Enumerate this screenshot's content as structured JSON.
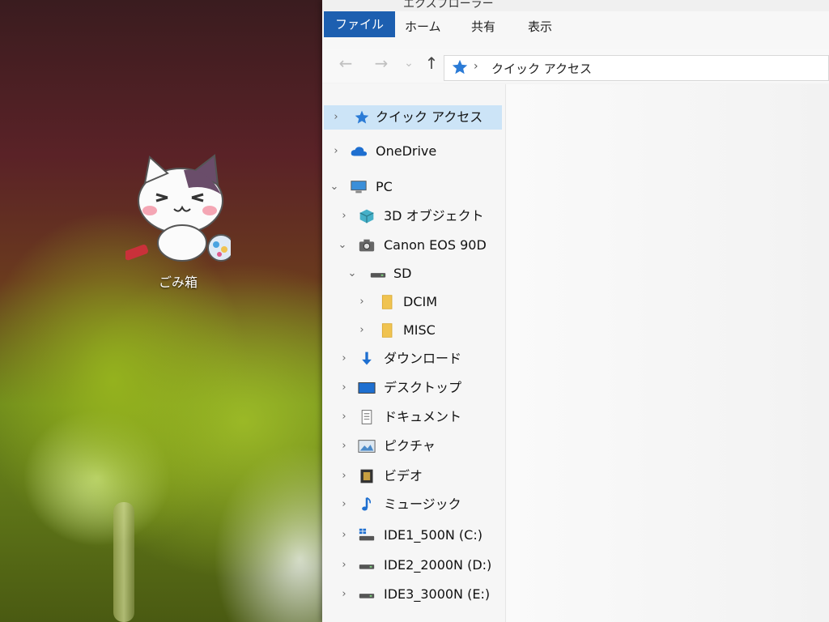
{
  "desktop": {
    "recycle_bin_label": "ごみ箱"
  },
  "window": {
    "title_fragment": "エクスプローラー"
  },
  "ribbon": {
    "tabs": [
      {
        "label": "ファイル"
      },
      {
        "label": "ホーム"
      },
      {
        "label": "共有"
      },
      {
        "label": "表示"
      }
    ]
  },
  "nav": {
    "back": "←",
    "forward": "→",
    "recent": "⌄",
    "up": "↑"
  },
  "address": {
    "separator": "›",
    "path": "クイック アクセス"
  },
  "navpane": {
    "items": [
      {
        "label": "クイック アクセス",
        "chevron": "›",
        "icon": "star-icon"
      },
      {
        "label": "OneDrive",
        "chevron": "›",
        "icon": "cloud-icon"
      },
      {
        "label": "PC",
        "chevron": "⌄",
        "icon": "monitor-icon"
      },
      {
        "label": "3D オブジェクト",
        "chevron": "›",
        "icon": "cube-icon"
      },
      {
        "label": "Canon EOS 90D",
        "chevron": "⌄",
        "icon": "camera-icon"
      },
      {
        "label": "SD",
        "chevron": "⌄",
        "icon": "drive-icon"
      },
      {
        "label": "DCIM",
        "chevron": "›",
        "icon": "folder-icon"
      },
      {
        "label": "MISC",
        "chevron": "›",
        "icon": "folder-icon"
      },
      {
        "label": "ダウンロード",
        "chevron": "›",
        "icon": "download-icon"
      },
      {
        "label": "デスクトップ",
        "chevron": "›",
        "icon": "desktop-icon"
      },
      {
        "label": "ドキュメント",
        "chevron": "›",
        "icon": "document-icon"
      },
      {
        "label": "ピクチャ",
        "chevron": "›",
        "icon": "picture-icon"
      },
      {
        "label": "ビデオ",
        "chevron": "›",
        "icon": "video-icon"
      },
      {
        "label": "ミュージック",
        "chevron": "›",
        "icon": "music-icon"
      },
      {
        "label": "IDE1_500N (C:)",
        "chevron": "›",
        "icon": "windows-drive-icon"
      },
      {
        "label": "IDE2_2000N (D:)",
        "chevron": "›",
        "icon": "drive-icon"
      },
      {
        "label": "IDE3_3000N (E:)",
        "chevron": "›",
        "icon": "drive-icon"
      }
    ]
  },
  "colors": {
    "file_tab": "#1d5fb0",
    "selection": "#cce4f7",
    "star": "#2b7bd6",
    "folder": "#f0c350"
  }
}
